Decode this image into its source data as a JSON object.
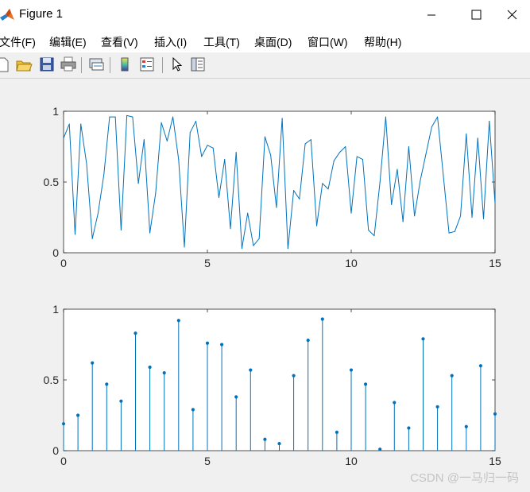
{
  "window": {
    "title": "Figure 1"
  },
  "menu": [
    "文件(F)",
    "编辑(E)",
    "查看(V)",
    "插入(I)",
    "工具(T)",
    "桌面(D)",
    "窗口(W)",
    "帮助(H)"
  ],
  "toolbar": [
    "new-icon",
    "open-icon",
    "save-icon",
    "print-icon",
    "link-icon",
    "colorbar-icon",
    "legend-icon",
    "pointer-icon",
    "property-inspector-icon"
  ],
  "watermark": "CSDN @一马归一码",
  "colors": {
    "line": "#0072bd"
  },
  "chart_data": [
    {
      "type": "line",
      "xlim": [
        0,
        15
      ],
      "ylim": [
        0,
        1
      ],
      "xticks": [
        "0",
        "5",
        "10",
        "15"
      ],
      "yticks": [
        "0",
        "0.5",
        "1"
      ],
      "x_start": 0,
      "x_step": 0.2,
      "values": [
        0.81,
        0.91,
        0.13,
        0.91,
        0.63,
        0.1,
        0.28,
        0.55,
        0.96,
        0.96,
        0.16,
        0.97,
        0.96,
        0.49,
        0.8,
        0.14,
        0.42,
        0.92,
        0.79,
        0.96,
        0.66,
        0.04,
        0.85,
        0.93,
        0.68,
        0.76,
        0.74,
        0.39,
        0.66,
        0.17,
        0.71,
        0.03,
        0.28,
        0.05,
        0.1,
        0.82,
        0.69,
        0.32,
        0.95,
        0.03,
        0.44,
        0.38,
        0.77,
        0.8,
        0.19,
        0.49,
        0.45,
        0.65,
        0.71,
        0.75,
        0.28,
        0.68,
        0.66,
        0.16,
        0.12,
        0.5,
        0.96,
        0.34,
        0.59,
        0.22,
        0.75,
        0.26,
        0.51,
        0.7,
        0.89,
        0.96,
        0.55,
        0.14,
        0.15,
        0.26,
        0.84,
        0.25,
        0.81,
        0.24,
        0.93,
        0.35
      ]
    },
    {
      "type": "stem",
      "xlim": [
        0,
        15
      ],
      "ylim": [
        0,
        1
      ],
      "xticks": [
        "0",
        "5",
        "10",
        "15"
      ],
      "yticks": [
        "0",
        "0.5",
        "1"
      ],
      "x_start": 0,
      "x_step": 0.5,
      "values": [
        0.19,
        0.25,
        0.62,
        0.47,
        0.35,
        0.83,
        0.59,
        0.55,
        0.92,
        0.29,
        0.76,
        0.75,
        0.38,
        0.57,
        0.08,
        0.05,
        0.53,
        0.78,
        0.93,
        0.13,
        0.57,
        0.47,
        0.01,
        0.34,
        0.16,
        0.79,
        0.31,
        0.53,
        0.17,
        0.6,
        0.26
      ]
    }
  ]
}
